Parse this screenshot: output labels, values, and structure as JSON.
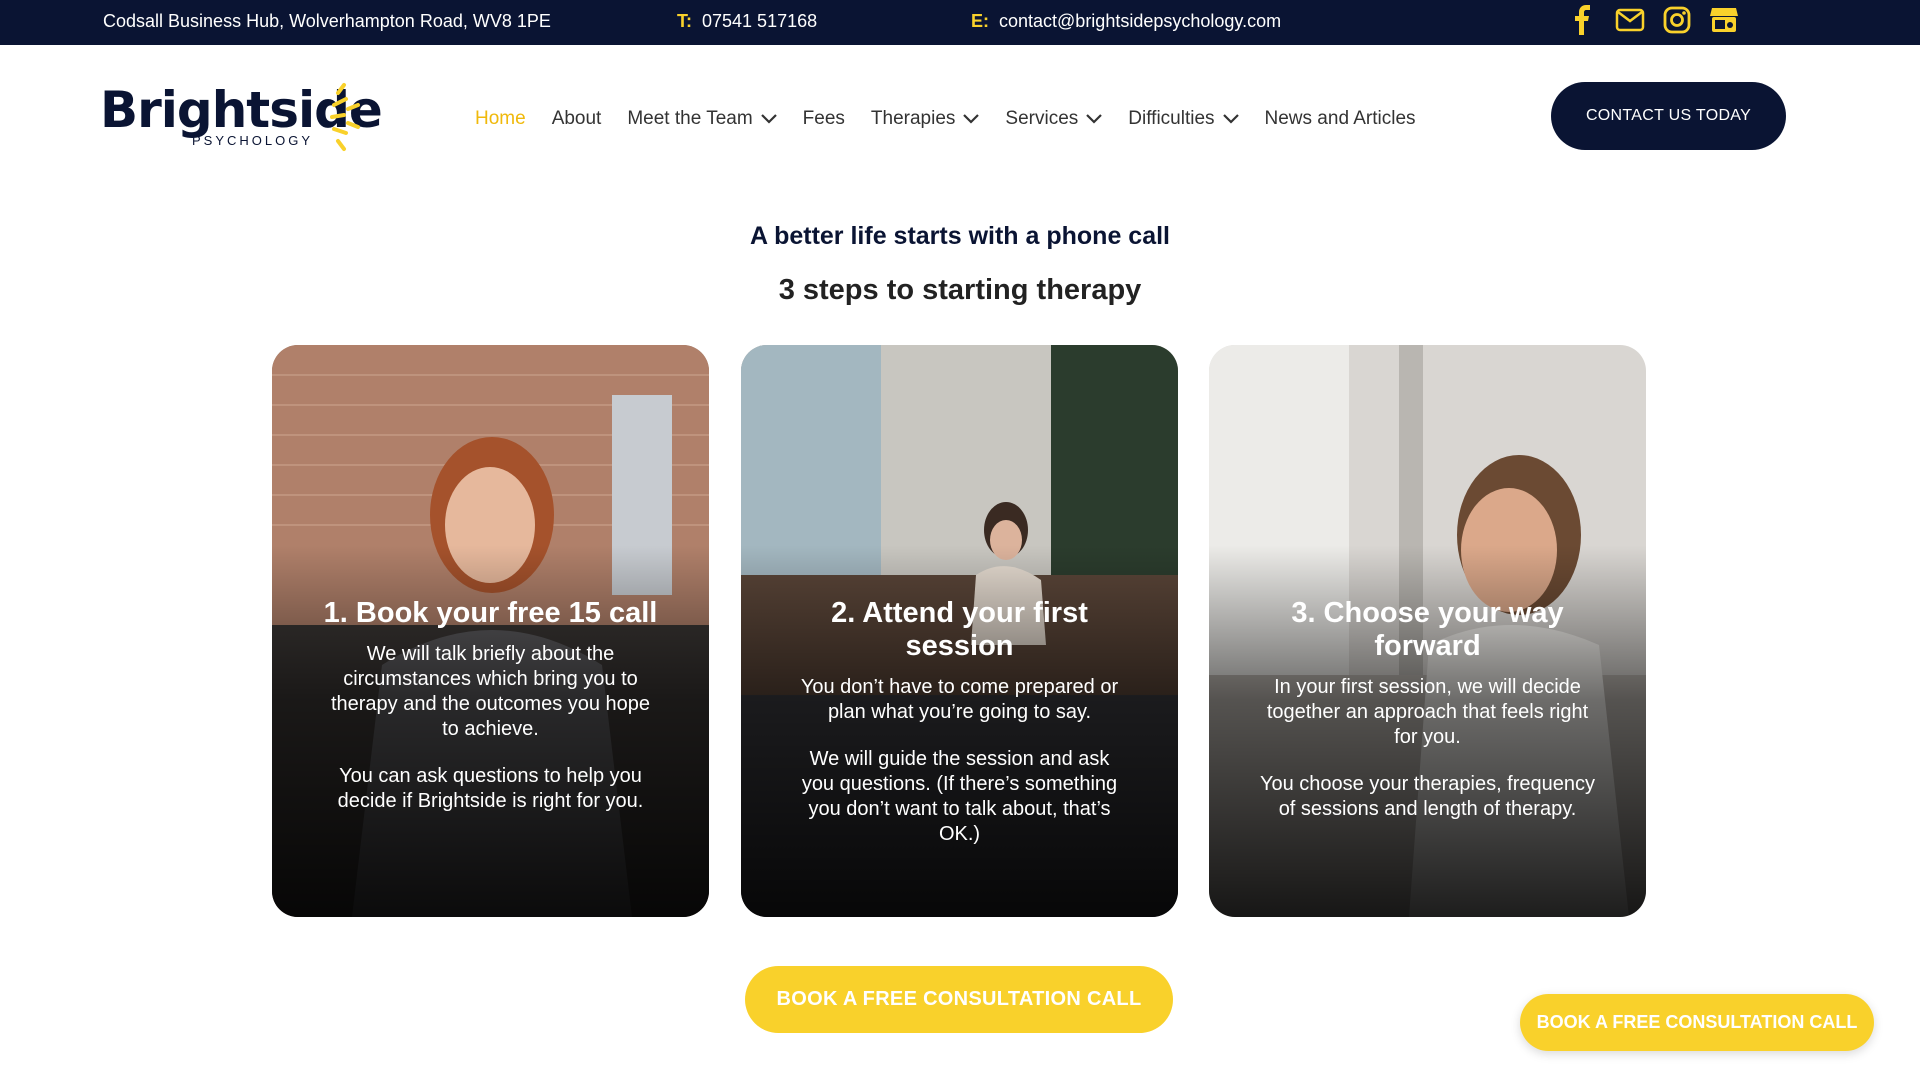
{
  "topbar": {
    "address": "Codsall Business Hub, Wolverhampton Road, WV8 1PE",
    "phone_label": "T:",
    "phone": "07541 517168",
    "email_label": "E:",
    "email": "contact@brightsidepsychology.com",
    "social_icons": [
      "facebook-icon",
      "mail-icon",
      "instagram-icon",
      "google-business-icon"
    ],
    "accent_color": "#f9d12b",
    "background_color": "#0a1433"
  },
  "header": {
    "logo_word": "Brightside",
    "logo_sub": "PSYCHOLOGY",
    "nav": [
      {
        "label": "Home",
        "active": true,
        "dropdown": false
      },
      {
        "label": "About",
        "active": false,
        "dropdown": false
      },
      {
        "label": "Meet the Team",
        "active": false,
        "dropdown": true
      },
      {
        "label": "Fees",
        "active": false,
        "dropdown": false
      },
      {
        "label": "Therapies",
        "active": false,
        "dropdown": true
      },
      {
        "label": "Services",
        "active": false,
        "dropdown": true
      },
      {
        "label": "Difficulties",
        "active": false,
        "dropdown": true
      },
      {
        "label": "News and Articles",
        "active": false,
        "dropdown": false
      }
    ],
    "contact_button": "CONTACT US TODAY"
  },
  "main": {
    "kicker": "A better life starts with a phone call",
    "title": "3 steps to starting therapy",
    "cards": [
      {
        "heading": "1. Book your free 15 call",
        "paragraphs": [
          "We will talk briefly about the circumstances which bring you to therapy and the outcomes you hope to achieve.",
          "You can ask questions to help you decide if Brightside is right for you."
        ]
      },
      {
        "heading": "2. Attend your first session",
        "paragraphs": [
          "You don’t have to come prepared or plan what you’re going to say.",
          "We will guide the session and ask you questions. (If there’s something you don’t want to talk about, that’s OK.)"
        ]
      },
      {
        "heading": "3. Choose your way forward",
        "paragraphs": [
          "In your first session, we will decide together an approach that feels right for you.",
          "You choose your therapies, frequency of sessions and length of therapy."
        ]
      }
    ],
    "book_button": "BOOK A FREE CONSULTATION CALL"
  },
  "floating_button": "BOOK A FREE CONSULTATION CALL"
}
